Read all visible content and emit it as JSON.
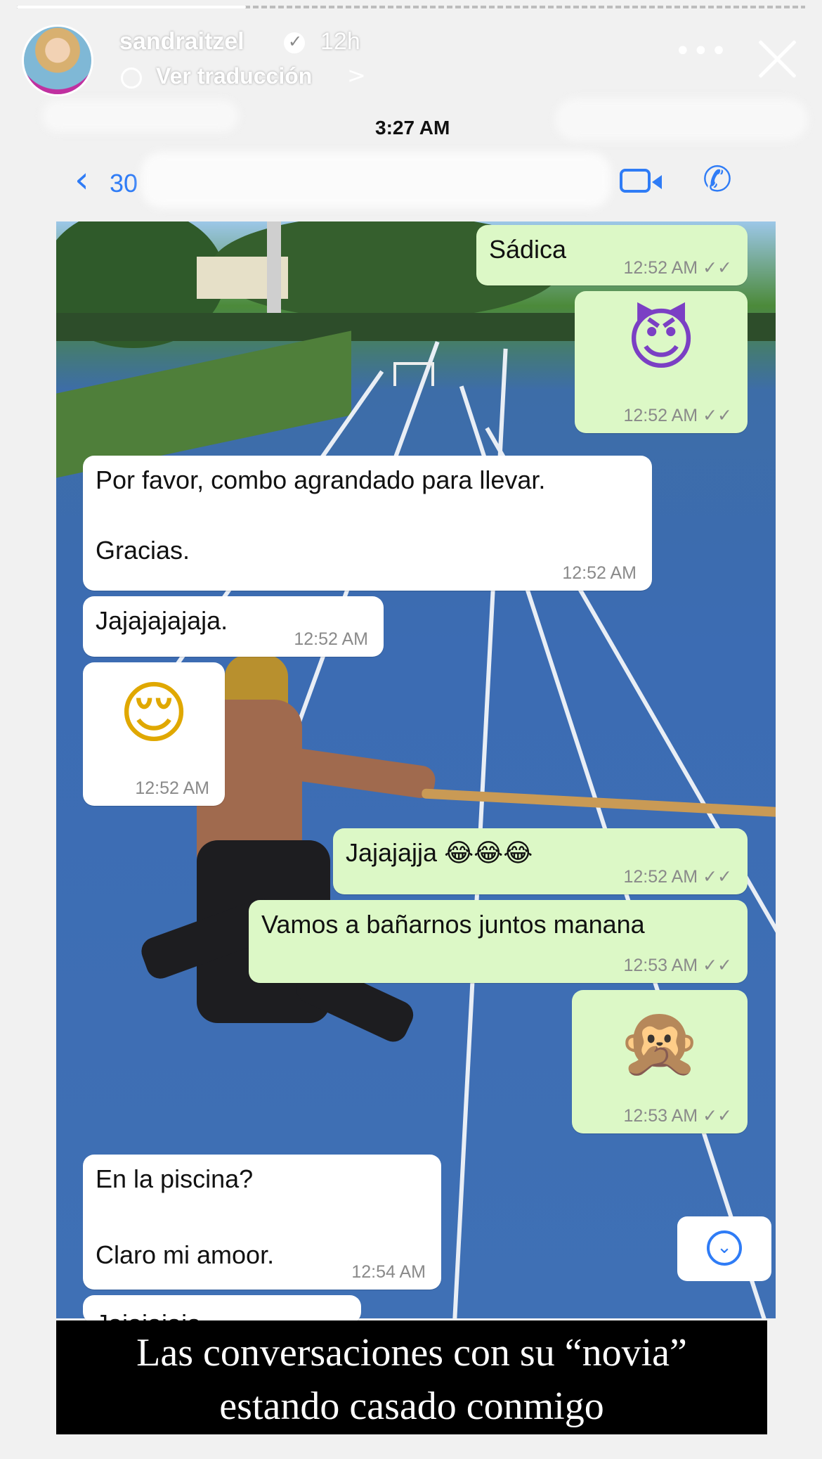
{
  "story": {
    "username": "sandraitzel",
    "verified_icon": "verified-badge-icon",
    "time_ago": "12h",
    "translate_label": "Ver traducción",
    "translate_chevron": ">",
    "more_icon": "•••",
    "close_icon": "close-icon"
  },
  "phone": {
    "status_time": "3:27 AM",
    "back_chevron": "‹",
    "back_label": "30",
    "video_icon": "video-call-icon",
    "call_icon": "phone-icon",
    "call_glyph": "✆"
  },
  "messages": [
    {
      "dir": "out",
      "text": "Sádica",
      "time": "12:52 AM",
      "ticks": "✓✓"
    },
    {
      "dir": "out",
      "text": "😈",
      "time": "12:52 AM",
      "ticks": "✓✓"
    },
    {
      "dir": "in",
      "text": "Por favor, combo agrandado para llevar.",
      "text2": "Gracias.",
      "time": "12:52 AM"
    },
    {
      "dir": "in",
      "text": "Jajajajajaja.",
      "time": "12:52 AM"
    },
    {
      "dir": "in",
      "text": "😌",
      "time": "12:52 AM"
    },
    {
      "dir": "out",
      "text": "Jajajajja 😂😂😂",
      "time": "12:52 AM",
      "ticks": "✓✓"
    },
    {
      "dir": "out",
      "text": "Vamos a bañarnos juntos manana",
      "time": "12:53 AM",
      "ticks": "✓✓"
    },
    {
      "dir": "out",
      "text": "🙊",
      "time": "12:53 AM",
      "ticks": "✓✓"
    },
    {
      "dir": "in",
      "text": "En la piscina?",
      "text2": "Claro mi amoor.",
      "time": "12:54 AM"
    },
    {
      "dir": "in",
      "text": "Jajajajaja",
      "time": ""
    }
  ],
  "scroll_down_glyph": "⌄",
  "caption": {
    "line1": "Las conversaciones con su “novia”",
    "line2": "estando casado conmigo"
  }
}
